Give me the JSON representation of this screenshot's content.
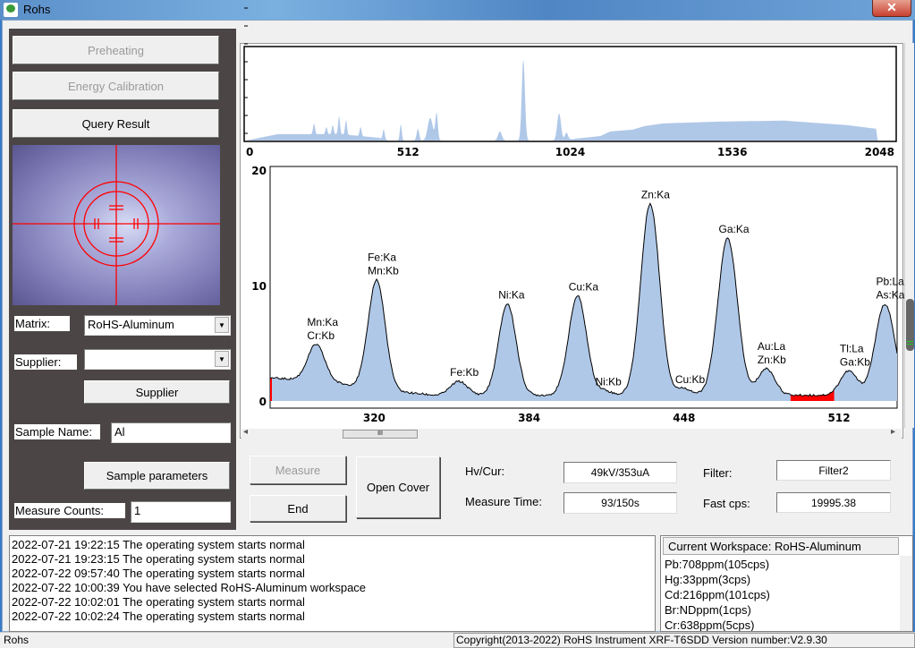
{
  "window": {
    "title": "Rohs",
    "close_label": "✕"
  },
  "left": {
    "preheating": "Preheating",
    "energy_calibration": "Energy Calibration",
    "query_result": "Query Result",
    "matrix_label": "Matrix:",
    "matrix_value": "RoHS-Aluminum",
    "supplier_label": "Supplier:",
    "supplier_value": "",
    "supplier_button": "Supplier",
    "sample_name_label": "Sample Name:",
    "sample_name_value": "Al",
    "sample_parameters": "Sample parameters",
    "measure_counts_label": "Measure Counts:",
    "measure_counts_value": "1",
    "dropdown_arrow": "▼"
  },
  "controls": {
    "measure": "Measure",
    "end": "End",
    "open_cover": "Open Cover",
    "hv_label": "Hv/Cur:",
    "hv_value": "49kV/353uA",
    "time_label": "Measure Time:",
    "time_value": "93/150s",
    "filter_label": "Filter:",
    "filter_value": "Filter2",
    "fastcps_label": "Fast cps:",
    "fastcps_value": "19995.38",
    "scroll_grip": "III",
    "scroll_left": "◂",
    "scroll_right": "▸"
  },
  "colors": {
    "fill": "#b0c8e8",
    "line": "#000000",
    "roi": "#ff0000",
    "crosshair": "#ff0000"
  },
  "chart_data": [
    {
      "type": "area",
      "xlim": [
        0,
        2048
      ],
      "xticks": [
        "0",
        "512",
        "1024",
        "1536",
        "2048"
      ],
      "xtick_values": [
        0,
        512,
        1024,
        1536,
        2048
      ],
      "y_scale": "relative",
      "background": [
        [
          0,
          0
        ],
        [
          100,
          0.07
        ],
        [
          300,
          0.07
        ],
        [
          420,
          0.03
        ],
        [
          450,
          0
        ],
        [
          1000,
          0
        ],
        [
          1040,
          0.02
        ],
        [
          1120,
          0.05
        ],
        [
          1150,
          0.1
        ],
        [
          1220,
          0.12
        ],
        [
          1260,
          0.16
        ],
        [
          1320,
          0.19
        ],
        [
          1500,
          0.21
        ],
        [
          1700,
          0.22
        ],
        [
          1900,
          0.17
        ],
        [
          1990,
          0.13
        ],
        [
          1995,
          0
        ]
      ],
      "peaks": [
        [
          215,
          0.12,
          3
        ],
        [
          254,
          0.08,
          3
        ],
        [
          274,
          0.1,
          3
        ],
        [
          294,
          0.2,
          3
        ],
        [
          316,
          0.16,
          3
        ],
        [
          362,
          0.1,
          3
        ],
        [
          435,
          0.11,
          3
        ],
        [
          489,
          0.18,
          3
        ],
        [
          543,
          0.13,
          4
        ],
        [
          582,
          0.25,
          8
        ],
        [
          602,
          0.3,
          4
        ],
        [
          802,
          0.1,
          6
        ],
        [
          876,
          0.9,
          5
        ],
        [
          989,
          0.3,
          6
        ],
        [
          1012,
          0.08,
          5
        ]
      ]
    },
    {
      "type": "area",
      "xlim": [
        277,
        536
      ],
      "ylim": [
        0,
        20
      ],
      "xticks": [
        "320",
        "384",
        "448",
        "512"
      ],
      "xtick_values": [
        320,
        384,
        448,
        512
      ],
      "yticks": [
        "0",
        "10",
        "20"
      ],
      "ytick_values": [
        0,
        10,
        20
      ],
      "roi": [
        492,
        510
      ],
      "background": [
        [
          277,
          2.0
        ],
        [
          300,
          1.7
        ],
        [
          312,
          1.3
        ],
        [
          330,
          0.8
        ],
        [
          345,
          0.5
        ],
        [
          536,
          0.5
        ]
      ],
      "peaks": [
        {
          "label": [
            "Mn:Ka",
            "Cr:Kb"
          ],
          "channel": 296,
          "counts": 4.9,
          "width": 3.5
        },
        {
          "label": [
            "Fe:Ka",
            "Mn:Kb"
          ],
          "channel": 321,
          "counts": 10.5,
          "width": 3.5
        },
        {
          "label": [
            "Fe:Kb"
          ],
          "channel": 355,
          "counts": 1.7,
          "width": 3.5
        },
        {
          "label": [
            "Ni:Ka"
          ],
          "channel": 375,
          "counts": 8.4,
          "width": 3.6
        },
        {
          "label": [
            "Cu:Ka"
          ],
          "channel": 404,
          "counts": 9.1,
          "width": 3.7
        },
        {
          "label": [
            "Ni:Kb"
          ],
          "channel": 415,
          "counts": 0.9,
          "width": 3
        },
        {
          "label": [
            "Zn:Ka"
          ],
          "channel": 434,
          "counts": 17.1,
          "width": 3.9
        },
        {
          "label": [
            "Cu:Kb"
          ],
          "channel": 448,
          "counts": 1.1,
          "width": 3
        },
        {
          "label": [
            "Ga:Ka"
          ],
          "channel": 466,
          "counts": 14.1,
          "width": 4.0
        },
        {
          "label": [
            "Au:La",
            "Zn:Kb"
          ],
          "channel": 482,
          "counts": 2.8,
          "width": 3.5
        },
        {
          "label": [
            "Tl:La",
            "Ga:Kb"
          ],
          "channel": 516,
          "counts": 2.6,
          "width": 3.5
        },
        {
          "label": [
            "Pb:La",
            "As:Ka"
          ],
          "channel": 531,
          "counts": 8.4,
          "width": 4.0
        }
      ]
    }
  ],
  "log": [
    "2022-07-21 19:22:15 The operating system starts normal",
    "2022-07-21 19:23:15 The operating system starts normal",
    "2022-07-22 09:57:40 The operating system starts normal",
    "2022-07-22 10:00:39 You have selected RoHS-Aluminum workspace",
    "2022-07-22 10:02:01 The operating system starts normal",
    "2022-07-22 10:02:24 The operating system starts normal"
  ],
  "workspace": {
    "header": "Current Workspace: RoHS-Aluminum",
    "results": [
      "Pb:708ppm(105cps)",
      "Hg:33ppm(3cps)",
      "Cd:216ppm(101cps)",
      "Br:NDppm(1cps)",
      "Cr:638ppm(5cps)"
    ]
  },
  "status": {
    "left": "Rohs",
    "right": "Copyright(2013-2022) RoHS Instrument XRF-T6SDD Version number:V2.9.30"
  }
}
